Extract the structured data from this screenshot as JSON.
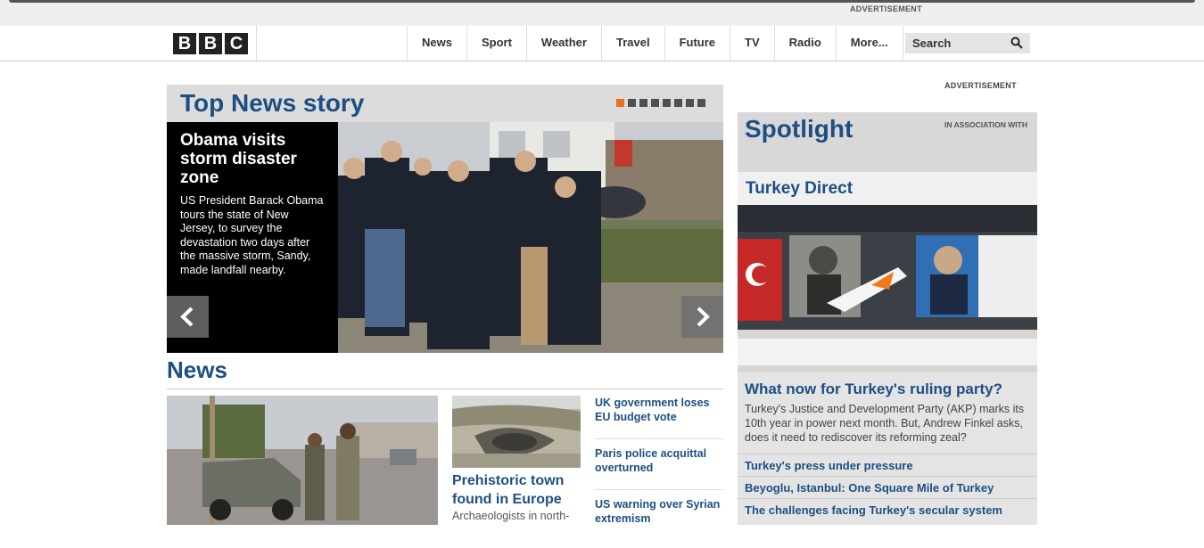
{
  "top_ad": "ADVERTISEMENT",
  "logo": [
    "B",
    "B",
    "C"
  ],
  "nav": [
    "News",
    "Sport",
    "Weather",
    "Travel",
    "Future",
    "TV",
    "Radio",
    "More..."
  ],
  "search": {
    "placeholder": "Search"
  },
  "top_news": {
    "heading": "Top News story",
    "dots_active": 0,
    "dots_count": 8,
    "headline": "Obama visits storm disaster zone",
    "summary": "US President Barack Obama tours the state of New Jersey, to survey the devastation two days after the massive storm, Sandy, made landfall nearby."
  },
  "news": {
    "heading": "News",
    "story2": {
      "headline": "Prehistoric town found in Europe",
      "summary": "Archaeologists in north-"
    },
    "links": [
      "UK government loses EU budget vote",
      "Paris police acquittal overturned",
      "US warning over Syrian extremism"
    ]
  },
  "side_ad": "ADVERTISEMENT",
  "spotlight": {
    "heading": "Spotlight",
    "assoc": "IN ASSOCIATION WITH",
    "subheading": "Turkey Direct",
    "story_headline": "What now for Turkey's ruling party?",
    "story_summary": "Turkey's Justice and Development Party (AKP) marks its 10th year in power next month. But, Andrew Finkel asks, does it need to rediscover its reforming zeal?",
    "links": [
      "Turkey's press under pressure",
      "Beyoglu, Istanbul: One Square Mile of Turkey",
      "The challenges facing Turkey's secular system"
    ]
  },
  "colors": {
    "accent": "#1d4f82",
    "dot_active": "#e8731a"
  }
}
